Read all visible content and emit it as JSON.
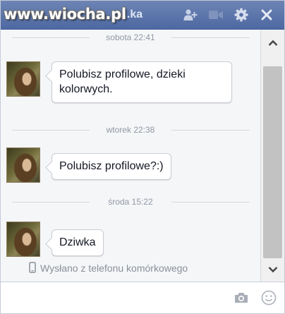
{
  "window": {
    "watermark": "www.wiocha.pl",
    "title": "...ka",
    "icons": [
      "add-friend-icon",
      "video-call-icon",
      "settings-gear-icon",
      "close-icon"
    ]
  },
  "conversation": {
    "messages": [
      {
        "timestamp": "sobota 22:41",
        "text": "Polubisz profilowe, dzieki kolorwych."
      },
      {
        "timestamp": "wtorek 22:38",
        "text": "Polubisz profilowe?:)"
      },
      {
        "timestamp": "środa 15:22",
        "text": "Dziwka"
      }
    ],
    "status": "Wysłano z telefonu komórkowego"
  },
  "composer": {
    "value": "",
    "placeholder": "",
    "icons": [
      "camera-icon",
      "emoticon-icon"
    ]
  },
  "colors": {
    "titlebar": "#4e69a2",
    "history_background": "#f5f6f8",
    "bubble_border": "#c9cdd4",
    "timestamp_text": "#9197a3"
  }
}
